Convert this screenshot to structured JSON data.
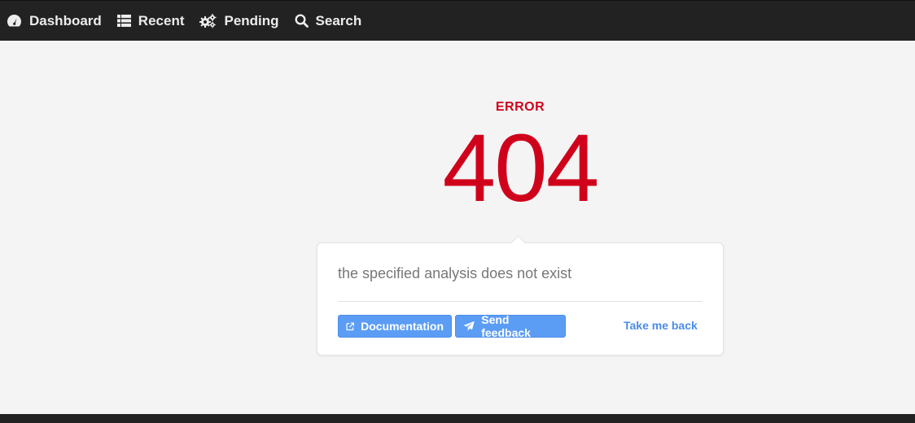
{
  "nav": {
    "items": [
      {
        "label": "Dashboard",
        "icon": "speedometer-icon"
      },
      {
        "label": "Recent",
        "icon": "list-icon"
      },
      {
        "label": "Pending",
        "icon": "gears-icon"
      },
      {
        "label": "Search",
        "icon": "search-icon"
      }
    ]
  },
  "error": {
    "label": "ERROR",
    "code": "404",
    "message": "the specified analysis does not exist"
  },
  "actions": {
    "documentation_label": "Documentation",
    "feedback_label": "Send feedback",
    "back_label": "Take me back"
  },
  "colors": {
    "navbar": "#222222",
    "background": "#f4f4f4",
    "error": "#d0021b",
    "button": "#5b9df5",
    "link": "#4a8de8"
  }
}
